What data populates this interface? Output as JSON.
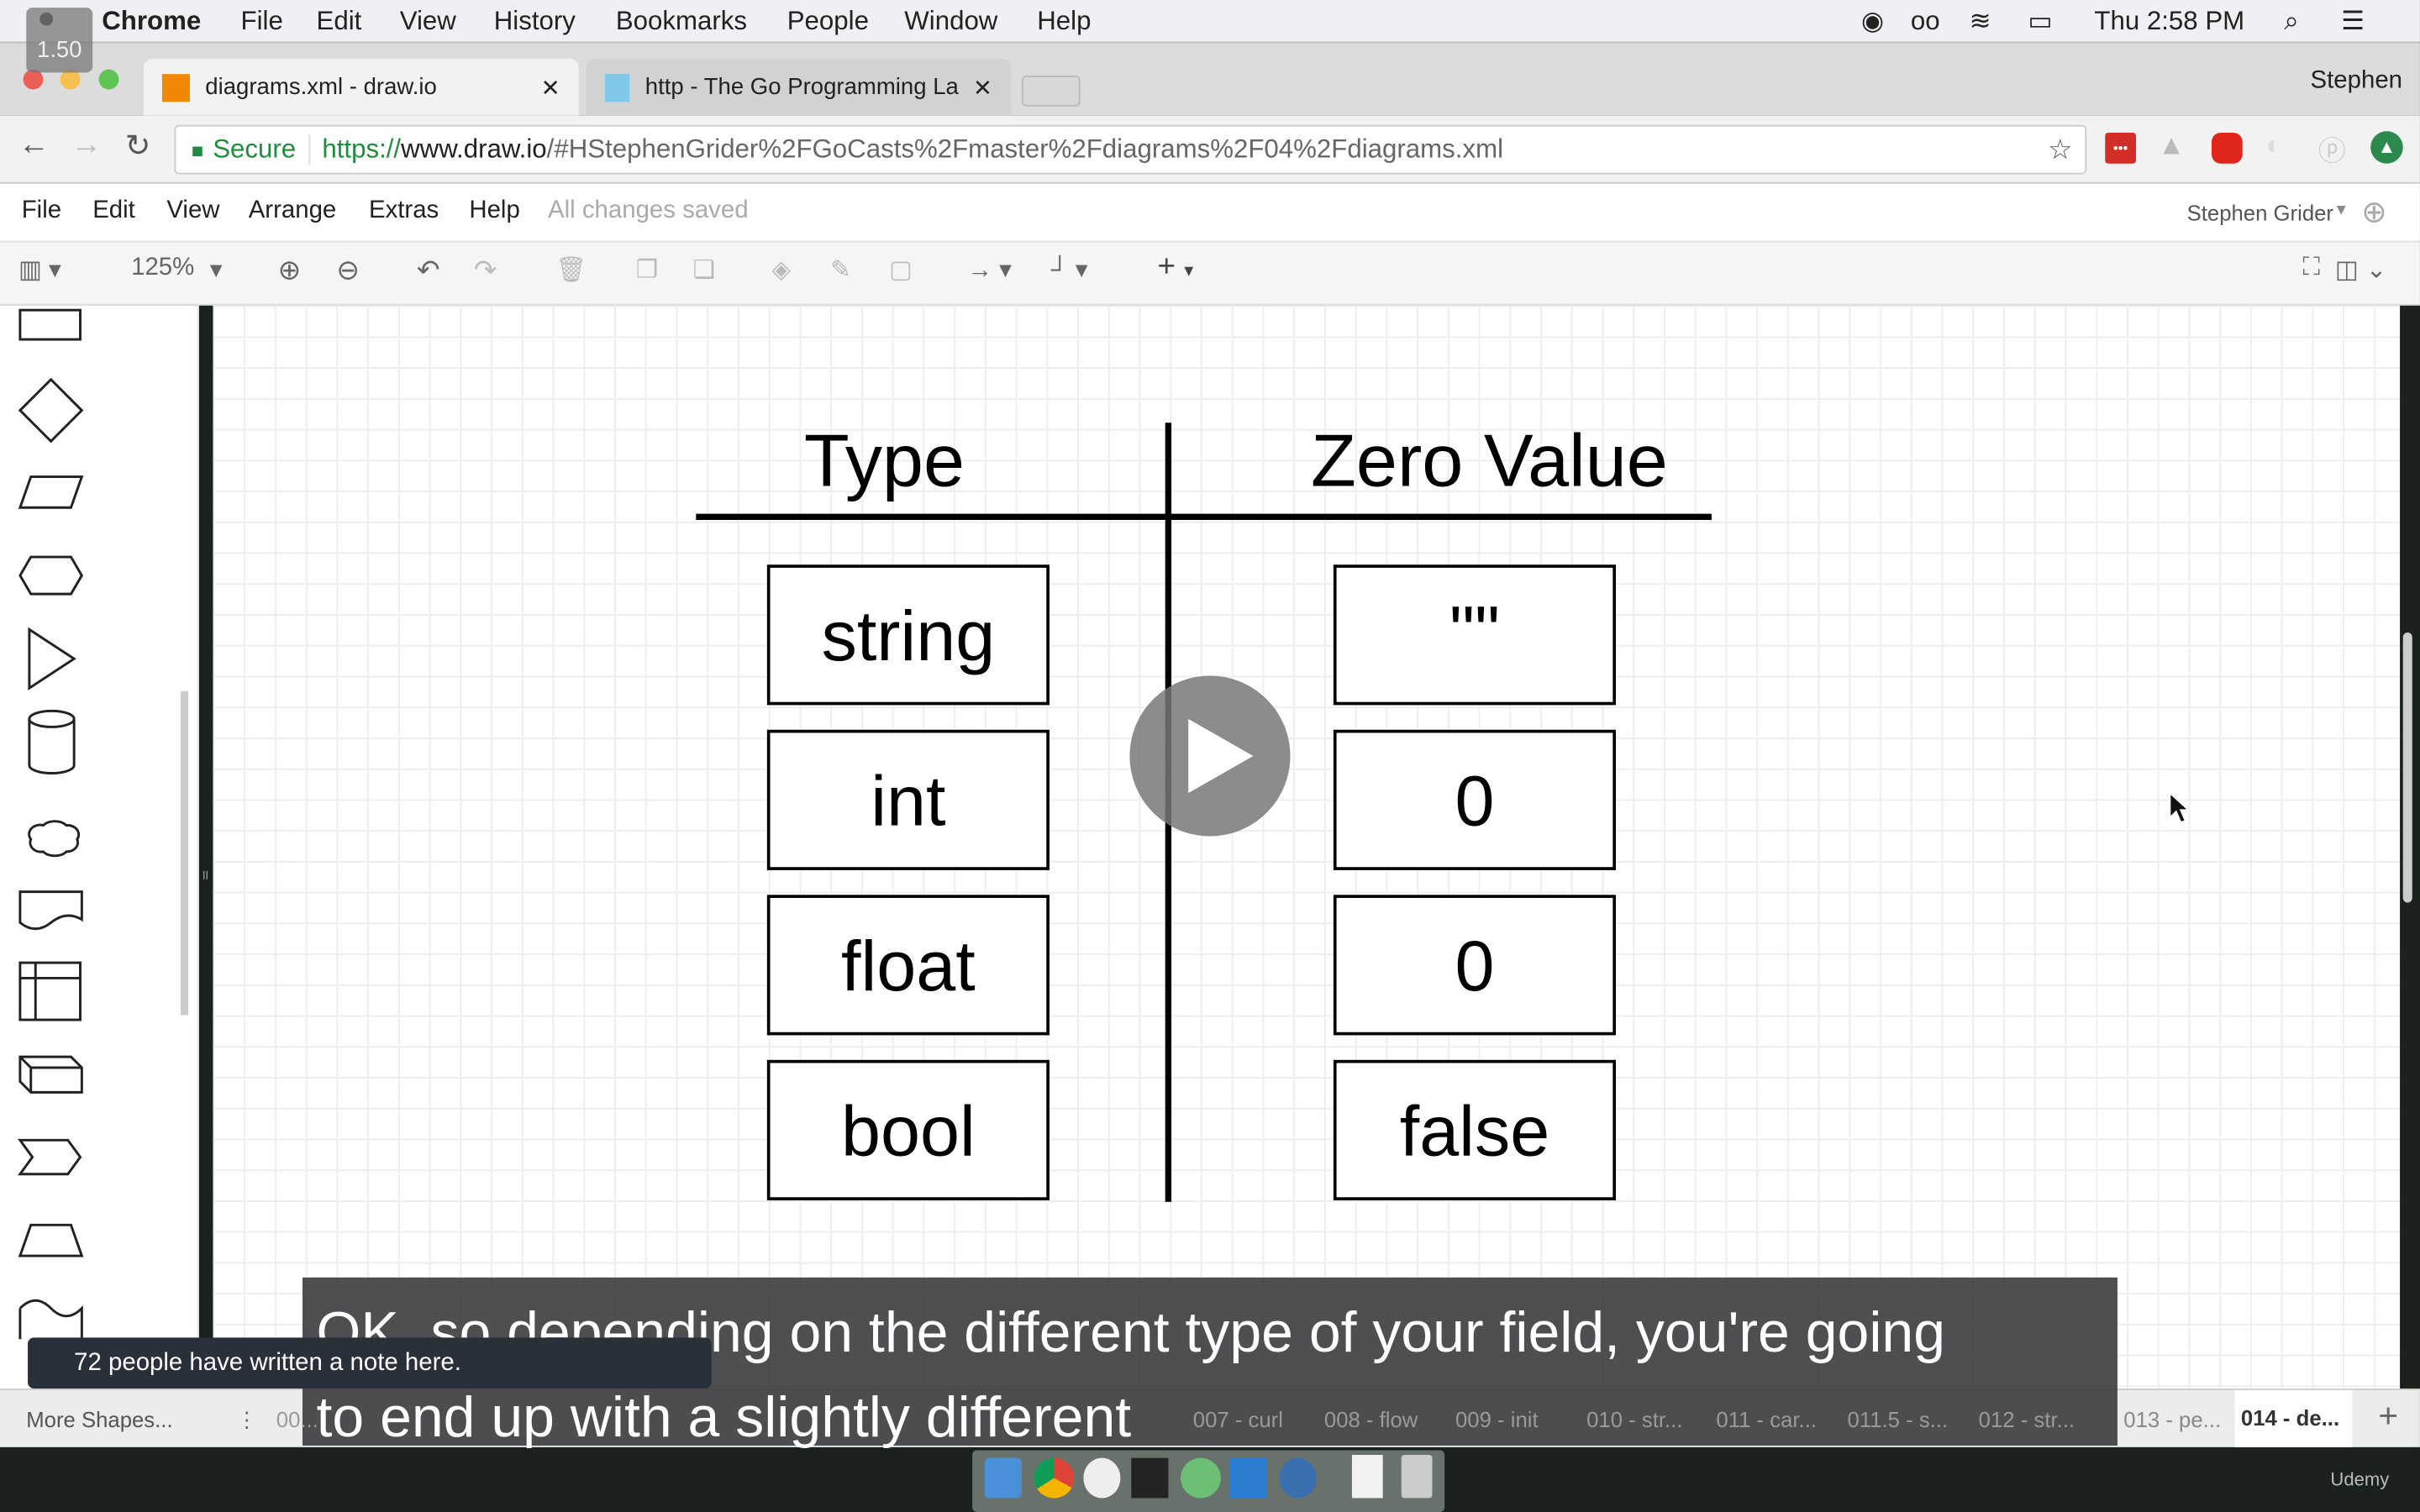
{
  "speed_badge": "1.50",
  "mac_menu": {
    "app": "Chrome",
    "items": [
      "File",
      "Edit",
      "View",
      "History",
      "Bookmarks",
      "People",
      "Window",
      "Help"
    ],
    "clock": "Thu 2:58 PM"
  },
  "tabs": [
    {
      "title": "diagrams.xml - draw.io",
      "active": true
    },
    {
      "title": "http - The Go Programming La",
      "active": false
    }
  ],
  "profile": "Stephen",
  "address": {
    "secure": "Secure",
    "url_scheme": "https://",
    "url_host": "www.draw.io",
    "url_path": "/#HStephenGrider%2FGoCasts%2Fmaster%2Fdiagrams%2F04%2Fdiagrams.xml"
  },
  "drawio_menu": {
    "items": [
      "File",
      "Edit",
      "View",
      "Arrange",
      "Extras",
      "Help"
    ],
    "status": "All changes saved",
    "user": "Stephen Grider"
  },
  "toolbar": {
    "zoom": "125%"
  },
  "diagram": {
    "headers": [
      "Type",
      "Zero Value"
    ],
    "rows": [
      {
        "type": "string",
        "zero": "\"\""
      },
      {
        "type": "int",
        "zero": "0"
      },
      {
        "type": "float",
        "zero": "0"
      },
      {
        "type": "bool",
        "zero": "false"
      }
    ]
  },
  "bottom": {
    "more_shapes": "More Shapes...",
    "pages": [
      "00...",
      "007 - curl",
      "008 - flow",
      "009 - init",
      "010 - str...",
      "011 - car...",
      "011.5 - s...",
      "012 - str...",
      "013 - pe...",
      "014 - de..."
    ],
    "active_page": "014 - de..."
  },
  "note": "72 people have written a note here.",
  "subtitle": {
    "line1": "OK, so depending on the different type of your field, you're going",
    "line2": "to end up with a slightly different"
  },
  "watermark": "Udemy",
  "colors": {
    "secure_green": "#1e8e3e",
    "drawio_orange": "#f08705",
    "subtitle_bg": "#37373a"
  }
}
